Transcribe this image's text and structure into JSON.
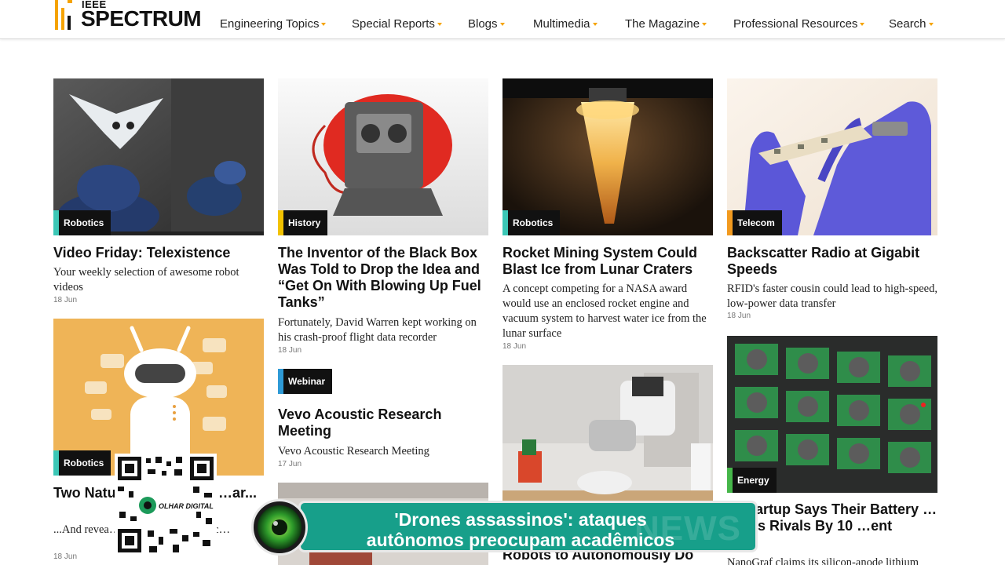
{
  "site": {
    "logo_top": "IEEE",
    "logo_main": "SPECTRUM",
    "accent_color": "#f5a300"
  },
  "nav": [
    {
      "label": "Engineering Topics"
    },
    {
      "label": "Special Reports"
    },
    {
      "label": "Blogs"
    },
    {
      "label": "Multimedia"
    },
    {
      "label": "The Magazine"
    },
    {
      "label": "Professional Resources"
    },
    {
      "label": "Search"
    }
  ],
  "cards": {
    "telexistence": {
      "tag": "Robotics",
      "tag_color": "#3cc7b6",
      "title": "Video Friday: Telexistence",
      "desc": "Your weekly selection of awesome robot videos",
      "date": "18 Jun"
    },
    "blackbox": {
      "tag": "History",
      "tag_color": "#f2c200",
      "title": "The Inventor of the Black Box Was Told to Drop the Idea and “Get On With Blowing Up Fuel Tanks”",
      "desc": "Fortunately, David Warren kept working on his crash-proof flight data recorder",
      "date": "18 Jun"
    },
    "rocket": {
      "tag": "Robotics",
      "tag_color": "#3cc7b6",
      "title": "Rocket Mining System Could Blast Ice from Lunar Craters",
      "desc": "A concept competing for a NASA award would use an enclosed rocket engine and vacuum system to harvest water ice from the lunar surface",
      "date": "18 Jun"
    },
    "backscatter": {
      "tag": "Telecom",
      "tag_color": "#f29a1f",
      "title": "Backscatter Radio at Gigabit Speeds",
      "desc": "RFID's faster cousin could lead to high-speed, low-power data transfer",
      "date": "18 Jun"
    },
    "algorithms": {
      "tag": "Robotics",
      "tag_color": "#3cc7b6",
      "title": "Two Natu… Algorithm… …ar...",
      "desc": "...And revea… …goted tendencies c…",
      "date": "18 Jun"
    },
    "vevo": {
      "tag": "Webinar",
      "tag_color": "#2e9ad6",
      "title": "Vevo Acoustic Research Meeting",
      "desc": "Vevo Acoustic Research Meeting",
      "date": "17 Jun"
    },
    "robotkitchen": {
      "title": "Robots to Autonomously Do"
    },
    "battery": {
      "tag": "Energy",
      "tag_color": "#45b649",
      "title": "…Startup Says Their Battery …Beats Rivals By 10 …ent",
      "desc": "NanoGraf claims its silicon-anode lithium"
    }
  },
  "overlay": {
    "ticker_line1": "'Drones assassinos': ataques",
    "ticker_line2": "autônomos preocupam acadêmicos",
    "watermark": "NEWS",
    "qr_brand": "OLHAR DIGITAL",
    "ticker_color": "#179f8a"
  }
}
